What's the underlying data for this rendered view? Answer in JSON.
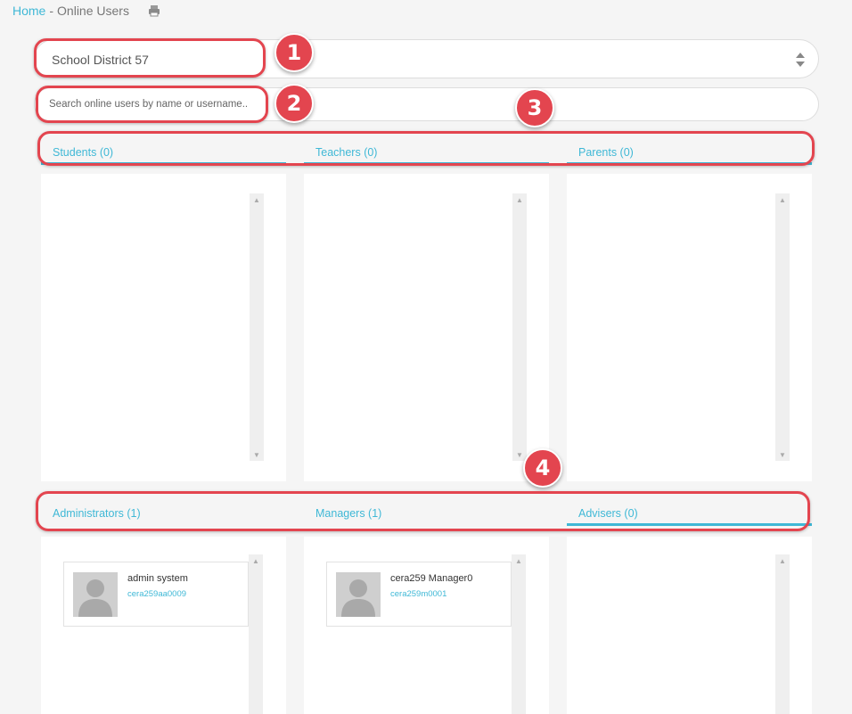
{
  "breadcrumb": {
    "home": "Home",
    "separator": "-",
    "current": "Online Users"
  },
  "print_icon": "printer-icon",
  "district_select": {
    "value": "School District 57"
  },
  "search": {
    "placeholder": "Search online users by name or username.."
  },
  "tabs_top": [
    {
      "label": "Students (0)"
    },
    {
      "label": "Teachers (0)"
    },
    {
      "label": "Parents (0)"
    }
  ],
  "tabs_bottom": [
    {
      "label": "Administrators (1)"
    },
    {
      "label": "Managers (1)"
    },
    {
      "label": "Advisers (0)"
    }
  ],
  "administrators": [
    {
      "name": "admin system",
      "username": "cera259aa0009"
    }
  ],
  "managers": [
    {
      "name": "cera259 Manager0",
      "username": "cera259m0001"
    }
  ],
  "callouts": [
    "1",
    "2",
    "3",
    "4"
  ],
  "colors": {
    "accent": "#3fb8d6",
    "callout": "#e3454f"
  }
}
